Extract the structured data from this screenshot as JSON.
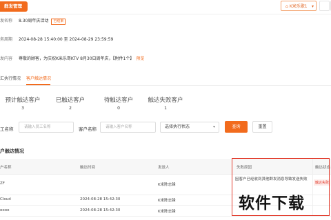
{
  "topbar": {
    "badge": "群发管理",
    "shop": "K米乐歌1",
    "shop_icon": "home-icon"
  },
  "info": {
    "name_label": "发名称",
    "name_value": "8.30周年庆活动",
    "name_tag": "已结束",
    "period_label": "务周期",
    "period_value": "2024-08-28 15:40:00 至 2024-08-29 23:59:59",
    "content_label": "发内容",
    "content_value": "尊敬的顾客，为庆祝K米乐哥KTV 8月30日周年庆，【附件1个】",
    "preview": "预览"
  },
  "tabs": [
    {
      "label": "汇执行情况"
    },
    {
      "label": "客户触达情况"
    }
  ],
  "stats": [
    {
      "title": "预计触达客户",
      "value": "3"
    },
    {
      "title": "已触达客户",
      "value": "2"
    },
    {
      "title": "待触达客户",
      "value": "0"
    },
    {
      "title": "触达失败客户",
      "value": "1"
    }
  ],
  "filters": {
    "staff_label": "工名称",
    "staff_placeholder": "请输入员工名称",
    "customer_label": "客户名称",
    "customer_placeholder": "请输入客户名称",
    "status_value": "选择执行状态",
    "query": "查询",
    "reset": "重置"
  },
  "section_title": "户触达情况",
  "table": {
    "headers": [
      "户名称",
      "触达时间",
      "发送人",
      "失败原因",
      "触达状态"
    ],
    "rows": [
      {
        "name": "ZF",
        "time": "",
        "sender": "K米陈志锋",
        "reason": "因客户已经收到其他群发消息导致发送失败",
        "status": "触达失败"
      },
      {
        "name": "Cloud",
        "time": "2024-08-28 15:42:30",
        "sender": "K米陈志锋",
        "reason": "",
        "status": ""
      },
      {
        "name": "oooo",
        "time": "2024-08-28 15:42:30",
        "sender": "K米陈志锋",
        "reason": "",
        "status": ""
      }
    ]
  },
  "watermark": "软件下载",
  "colors": {
    "accent": "#f26b1d",
    "danger": "#e23b2c"
  }
}
